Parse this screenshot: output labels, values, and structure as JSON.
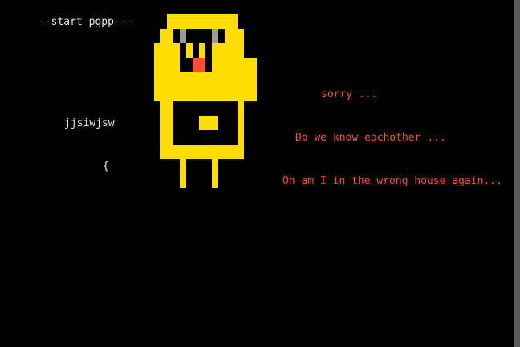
{
  "console": {
    "start_line": "--start pgpp---",
    "line_2": "jjsiwjsw",
    "line_3": "{"
  },
  "dialogue": {
    "line_1": "sorry ...",
    "line_2": "Do we know eachother ...",
    "line_3": "Oh am I in the wrong house again..."
  },
  "colors": {
    "background": "#000000",
    "console_text": "#e8e8e8",
    "dialogue_text": "#ff4d3a",
    "character_body": "#ffdd00",
    "character_eyes": "#9a9a9a",
    "character_tongue": "#ff4d3a"
  },
  "character": {
    "icon": "yellow-pixel-creature-icon"
  }
}
